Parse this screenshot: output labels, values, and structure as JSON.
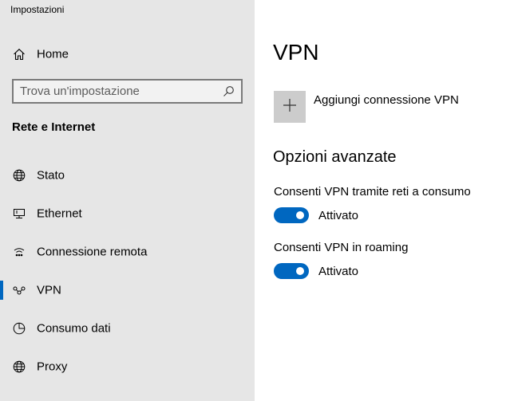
{
  "window": {
    "title": "Impostazioni"
  },
  "sidebar": {
    "home_label": "Home",
    "search": {
      "placeholder": "Trova un'impostazione",
      "value": ""
    },
    "section_title": "Rete e Internet",
    "items": [
      {
        "label": "Stato",
        "icon": "globe-icon",
        "selected": false
      },
      {
        "label": "Ethernet",
        "icon": "ethernet-icon",
        "selected": false
      },
      {
        "label": "Connessione remota",
        "icon": "dial-up-icon",
        "selected": false
      },
      {
        "label": "VPN",
        "icon": "vpn-icon",
        "selected": true
      },
      {
        "label": "Consumo dati",
        "icon": "data-usage-icon",
        "selected": false
      },
      {
        "label": "Proxy",
        "icon": "globe-icon",
        "selected": false
      }
    ]
  },
  "main": {
    "title": "VPN",
    "add_connection_label": "Aggiungi connessione VPN",
    "advanced_heading": "Opzioni avanzate",
    "options": [
      {
        "label": "Consenti VPN tramite reti a consumo",
        "state": "Attivato",
        "on": true
      },
      {
        "label": "Consenti VPN in roaming",
        "state": "Attivato",
        "on": true
      }
    ]
  },
  "colors": {
    "accent": "#0067c0",
    "sidebar_bg": "#e6e6e6",
    "tile_bg": "#cccccc"
  }
}
